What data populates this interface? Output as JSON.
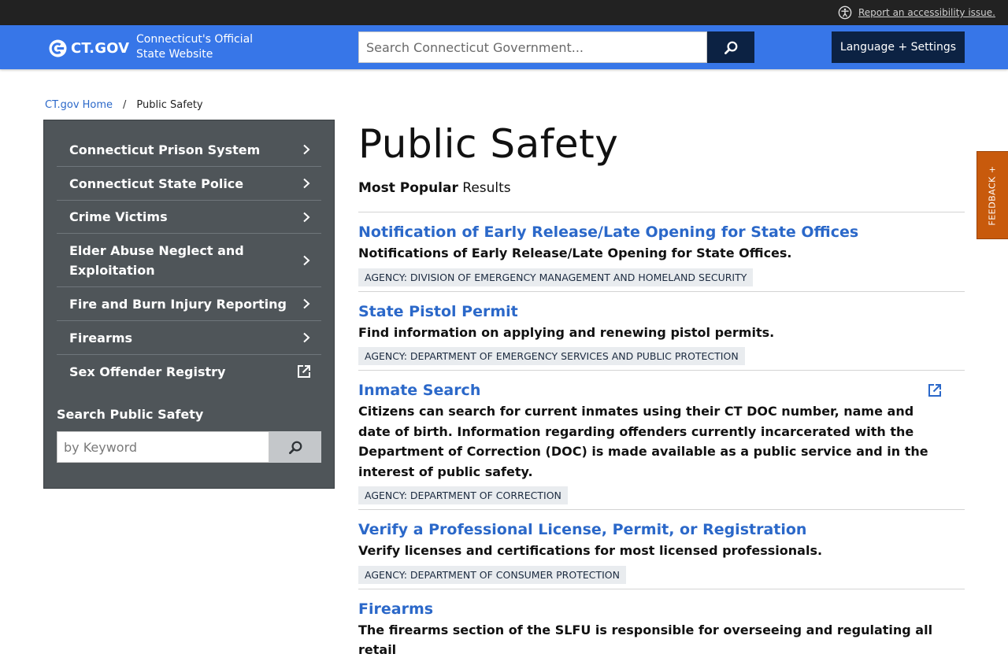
{
  "topbar": {
    "accessibility_link": "Report an accessibility issue."
  },
  "header": {
    "logo_text": "CT.GOV",
    "tagline": "Connecticut's Official State Website",
    "search_placeholder": "Search Connecticut Government...",
    "language_button": "Language + Settings"
  },
  "breadcrumb": {
    "home": "CT.gov Home",
    "separator": "/",
    "current": "Public Safety"
  },
  "sidebar": {
    "items": [
      {
        "label": "Connecticut Prison System",
        "icon": "chevron-right-icon"
      },
      {
        "label": "Connecticut State Police",
        "icon": "chevron-right-icon"
      },
      {
        "label": "Crime Victims",
        "icon": "chevron-right-icon"
      },
      {
        "label": "Elder Abuse Neglect and Exploitation",
        "icon": "chevron-right-icon"
      },
      {
        "label": "Fire and Burn Injury Reporting",
        "icon": "chevron-right-icon"
      },
      {
        "label": "Firearms",
        "icon": "chevron-right-icon"
      },
      {
        "label": "Sex Offender Registry",
        "icon": "external-link-icon"
      }
    ],
    "search_label": "Search Public Safety",
    "search_placeholder": "by Keyword"
  },
  "main": {
    "title": "Public Safety",
    "popular_bold": "Most Popular",
    "popular_rest": "Results",
    "results": [
      {
        "title": "Notification of Early Release/Late Opening for State Offices",
        "description": "Notifications of Early Release/Late Opening for State Offices.",
        "agency": "AGENCY: DIVISION OF EMERGENCY MANAGEMENT AND HOMELAND SECURITY"
      },
      {
        "title": "State Pistol Permit",
        "description": "Find information on applying and renewing pistol permits.",
        "agency": "AGENCY: DEPARTMENT OF EMERGENCY SERVICES AND PUBLIC PROTECTION"
      },
      {
        "title": "Inmate Search",
        "description": "Citizens can search for current inmates using their CT DOC number, name and date of birth. Information regarding offenders currently incarcerated with the Department of Correction (DOC) is made available as a public service and in the interest of public safety.",
        "agency": "AGENCY: DEPARTMENT OF CORRECTION"
      },
      {
        "title": "Verify a Professional License, Permit, or Registration",
        "description": "Verify licenses and certifications for most licensed professionals.",
        "agency": "AGENCY: DEPARTMENT OF CONSUMER PROTECTION"
      },
      {
        "title": "Firearms",
        "description": "The firearms section of the SLFU is responsible for overseeing and regulating all retail",
        "agency": ""
      }
    ]
  },
  "feedback": {
    "label": "FEEDBACK +"
  },
  "colors": {
    "topbar": "#222222",
    "header": "#3776e8",
    "navy": "#0c2243",
    "sidebar": "#4f5559",
    "link": "#2b68c9",
    "feedback": "#c85a0c"
  }
}
